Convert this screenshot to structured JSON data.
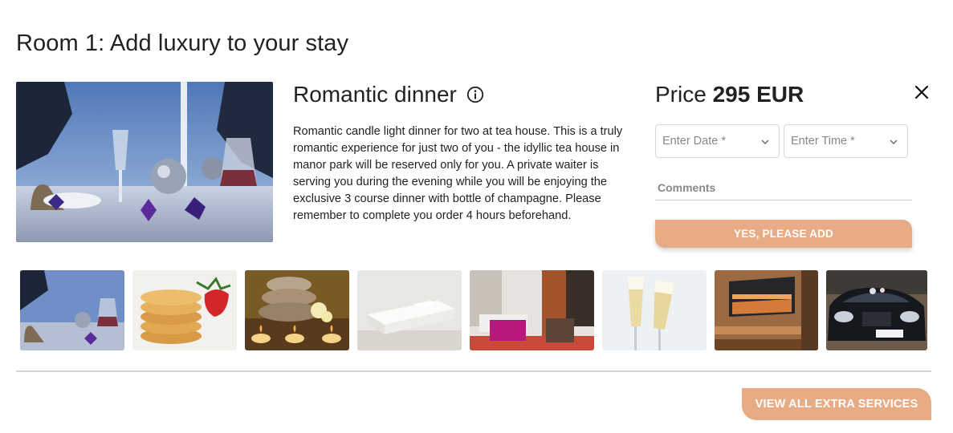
{
  "page": {
    "title": "Room 1: Add luxury to your stay"
  },
  "service": {
    "name": "Romantic dinner",
    "info_icon": "info-circle-icon",
    "description": "Romantic candle light dinner for two at tea house. This is a truly romantic experience for just two of you - the idyllic tea house in manor park will be reserved only for you. A private waiter is serving you during the evening while you will be enjoying the exclusive 3 course dinner with bottle of champagne. Please remember to complete you order 4 hours beforehand."
  },
  "order": {
    "price_prefix": "Price",
    "price_value": "295 EUR",
    "date_placeholder": "Enter Date *",
    "time_placeholder": "Enter Time *",
    "comments_placeholder": "Comments",
    "add_button": "YES, PLEASE ADD"
  },
  "thumbnails": [
    {
      "name": "romantic-dinner"
    },
    {
      "name": "cookies"
    },
    {
      "name": "spa-stones-candles"
    },
    {
      "name": "extra-bed"
    },
    {
      "name": "room-upgrade"
    },
    {
      "name": "champagne"
    },
    {
      "name": "sauna"
    },
    {
      "name": "car-transfer"
    }
  ],
  "footer": {
    "view_all_button": "VIEW ALL EXTRA SERVICES"
  },
  "colors": {
    "accent": "#e7ac86",
    "text": "#222222",
    "divider": "#d6d6d6"
  }
}
